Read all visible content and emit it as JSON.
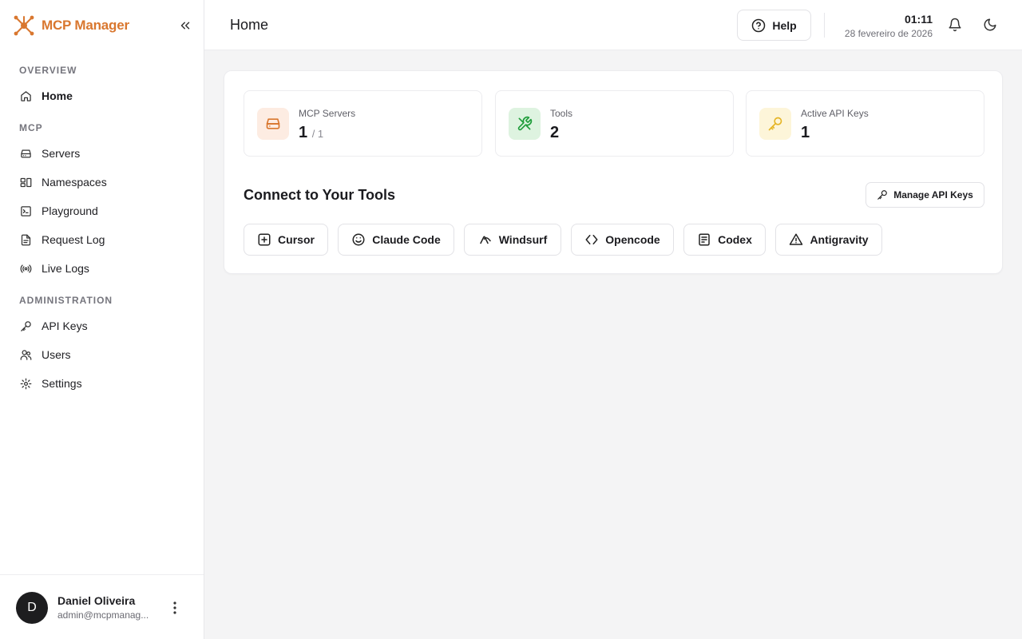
{
  "brand": {
    "name": "MCP Manager",
    "accent": "#d9772f"
  },
  "sidebar": {
    "sections": [
      {
        "title": "OVERVIEW",
        "items": [
          {
            "label": "Home",
            "icon": "home-icon",
            "active": true
          }
        ]
      },
      {
        "title": "MCP",
        "items": [
          {
            "label": "Servers",
            "icon": "server-icon"
          },
          {
            "label": "Namespaces",
            "icon": "namespaces-icon"
          },
          {
            "label": "Playground",
            "icon": "terminal-icon"
          },
          {
            "label": "Request Log",
            "icon": "file-icon"
          },
          {
            "label": "Live Logs",
            "icon": "radio-icon"
          }
        ]
      },
      {
        "title": "ADMINISTRATION",
        "items": [
          {
            "label": "API Keys",
            "icon": "key-icon"
          },
          {
            "label": "Users",
            "icon": "users-icon"
          },
          {
            "label": "Settings",
            "icon": "gear-icon"
          }
        ]
      }
    ]
  },
  "user": {
    "initial": "D",
    "name": "Daniel Oliveira",
    "email": "admin@mcpmanag..."
  },
  "header": {
    "title": "Home",
    "help_label": "Help",
    "time": "01:11",
    "date": "28 fevereiro de 2026"
  },
  "stats": [
    {
      "label": "MCP Servers",
      "value": "1",
      "sub": "/ 1",
      "icon": "server-icon",
      "bg": "#fdece2",
      "color": "#d9772f"
    },
    {
      "label": "Tools",
      "value": "2",
      "sub": "",
      "icon": "tools-icon",
      "bg": "#def3e0",
      "color": "#1f9d3a"
    },
    {
      "label": "Active API Keys",
      "value": "1",
      "sub": "",
      "icon": "key-icon",
      "bg": "#fdf5d9",
      "color": "#e5b424"
    }
  ],
  "connect": {
    "title": "Connect to Your Tools",
    "manage_label": "Manage API Keys",
    "tools": [
      {
        "label": "Cursor",
        "icon": "plus-square-icon"
      },
      {
        "label": "Claude Code",
        "icon": "smile-icon"
      },
      {
        "label": "Windsurf",
        "icon": "wave-icon"
      },
      {
        "label": "Opencode",
        "icon": "code-icon"
      },
      {
        "label": "Codex",
        "icon": "document-icon"
      },
      {
        "label": "Antigravity",
        "icon": "triangle-alert-icon"
      }
    ]
  }
}
